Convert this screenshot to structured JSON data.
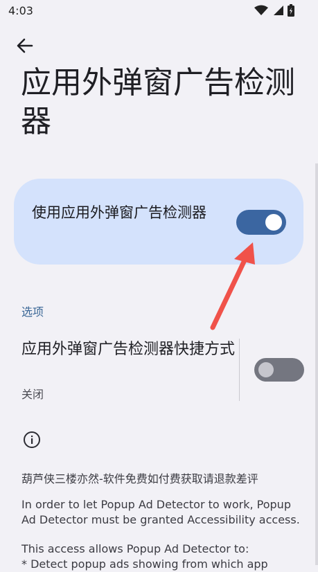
{
  "status_bar": {
    "time": "4:03"
  },
  "header": {
    "back_icon": "arrow-back-icon",
    "title": "应用外弹窗广告检测器"
  },
  "main_switch": {
    "label": "使用应用外弹窗广告检测器",
    "enabled": true,
    "accent_color": "#3b66a1",
    "card_color": "#d4e2fc"
  },
  "options": {
    "header": "选项",
    "shortcut": {
      "title": "应用外弹窗广告检测器快捷方式",
      "subtitle": "关闭",
      "enabled": false
    }
  },
  "about": {
    "info_icon": "info-icon",
    "note": "葫芦侠三楼亦然-软件免费如付费获取请退款差评",
    "paragraph1": "In order to let Popup Ad Detector to work, Popup Ad Detector must be granted Accessibility access.",
    "paragraph2": "This access allows Popup Ad Detector to:",
    "paragraph3": "* Detect popup ads showing from which app"
  },
  "annotation": {
    "arrow_color": "#f0524a"
  }
}
